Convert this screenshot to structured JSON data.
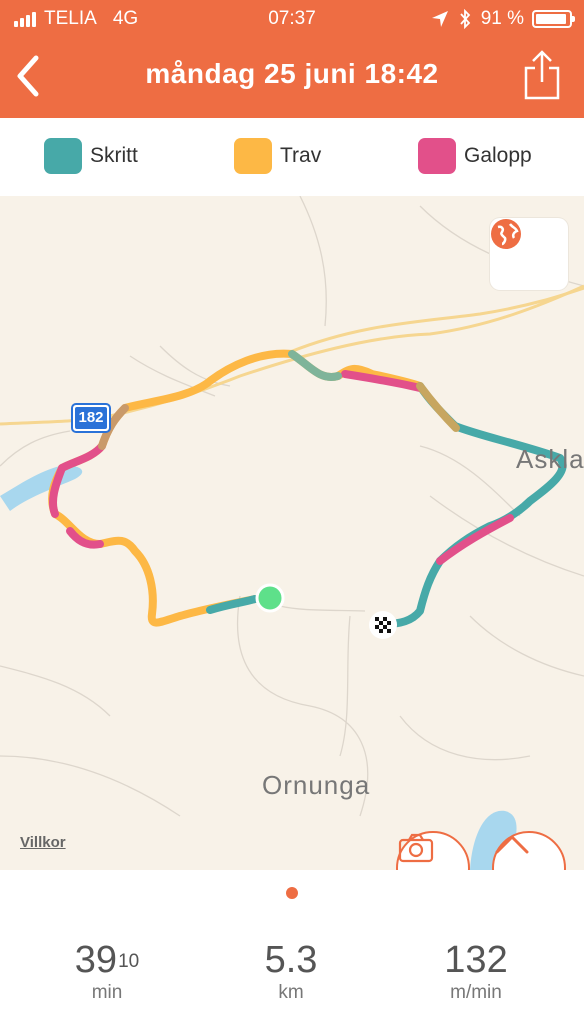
{
  "status_bar": {
    "carrier": "TELIA",
    "network": "4G",
    "time": "07:37",
    "battery_percent": "91 %",
    "battery_level": 0.91
  },
  "header": {
    "title": "måndag 25 juni 18:42",
    "back_icon": "chevron-left-icon",
    "share_icon": "share-icon"
  },
  "legend": [
    {
      "label": "Skritt",
      "color": "#47a9a8"
    },
    {
      "label": "Trav",
      "color": "#fdb845"
    },
    {
      "label": "Galopp",
      "color": "#e2508a"
    }
  ],
  "map": {
    "road_number": "182",
    "places": {
      "center": "Ornunga",
      "right": "Askla"
    },
    "terms_link": "Villkor",
    "globe_icon": "globe-icon",
    "camera_icon": "camera-icon",
    "expand_icon": "chevron-up-icon"
  },
  "page_indicator": {
    "current": 1,
    "total": 1
  },
  "stats": [
    {
      "value": "39",
      "sup": "10",
      "unit": "min"
    },
    {
      "value": "5.3",
      "sup": "",
      "unit": "km"
    },
    {
      "value": "132",
      "sup": "",
      "unit": "m/min"
    }
  ],
  "colors": {
    "accent": "#ee6d43",
    "map_background": "#f8f2e8",
    "start_marker": "#5ee08a"
  }
}
